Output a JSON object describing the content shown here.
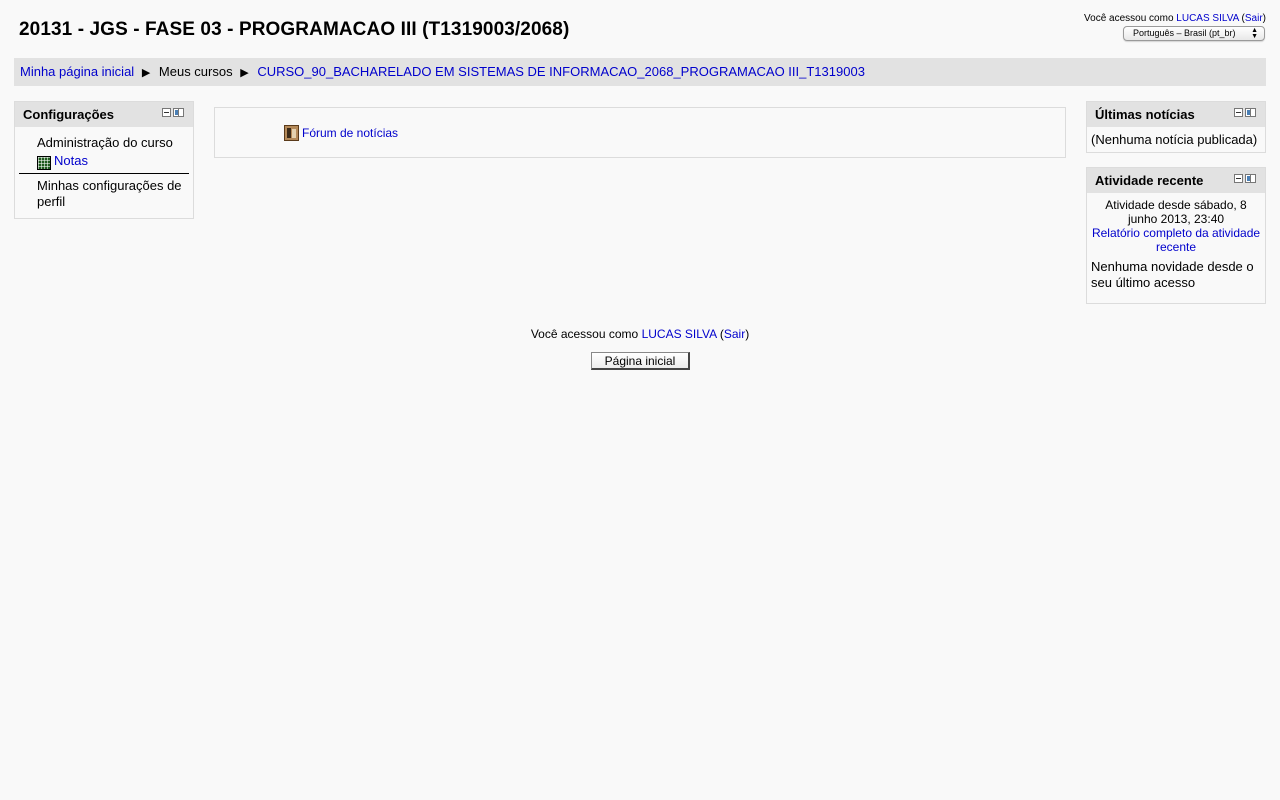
{
  "header": {
    "course_title": "20131 - JGS - FASE 03 - PROGRAMACAO III (T1319003/2068)",
    "login_prefix": "Você acessou como",
    "user_name": "LUCAS SILVA",
    "logout_open": "(",
    "logout_label": "Sair",
    "logout_close": ")",
    "language": "Português ‎– Brasil ‎(pt_br)‎"
  },
  "breadcrumb": {
    "home": "Minha página inicial",
    "separator": "▶",
    "my_courses": "Meus cursos",
    "course": "CURSO_90_BACHARELADO EM SISTEMAS DE INFORMACAO_2068_PROGRAMACAO III_T1319003"
  },
  "settings_block": {
    "title": "Configurações",
    "course_admin": "Administração do curso",
    "grades": "Notas",
    "profile_settings": "Minhas configurações de perfil"
  },
  "main": {
    "forum_link": "Fórum de notícias"
  },
  "news_block": {
    "title": "Últimas notícias",
    "empty": "(Nenhuma notícia publicada)"
  },
  "recent_block": {
    "title": "Atividade recente",
    "since": "Atividade desde sábado, 8 junho 2013, 23:40",
    "report_link": "Relatório completo da atividade recente",
    "none": "Nenhuma novidade desde o seu último acesso"
  },
  "footer": {
    "login_prefix": "Você acessou como",
    "user_name": "LUCAS SILVA",
    "logout_open": "(",
    "logout_label": "Sair",
    "logout_close": ")",
    "home_button": "Página inicial"
  },
  "icons": {
    "grades": "grades-table-icon",
    "forum": "forum-icon",
    "block_hide": "block-hide-icon",
    "block_dock": "block-dock-icon"
  }
}
